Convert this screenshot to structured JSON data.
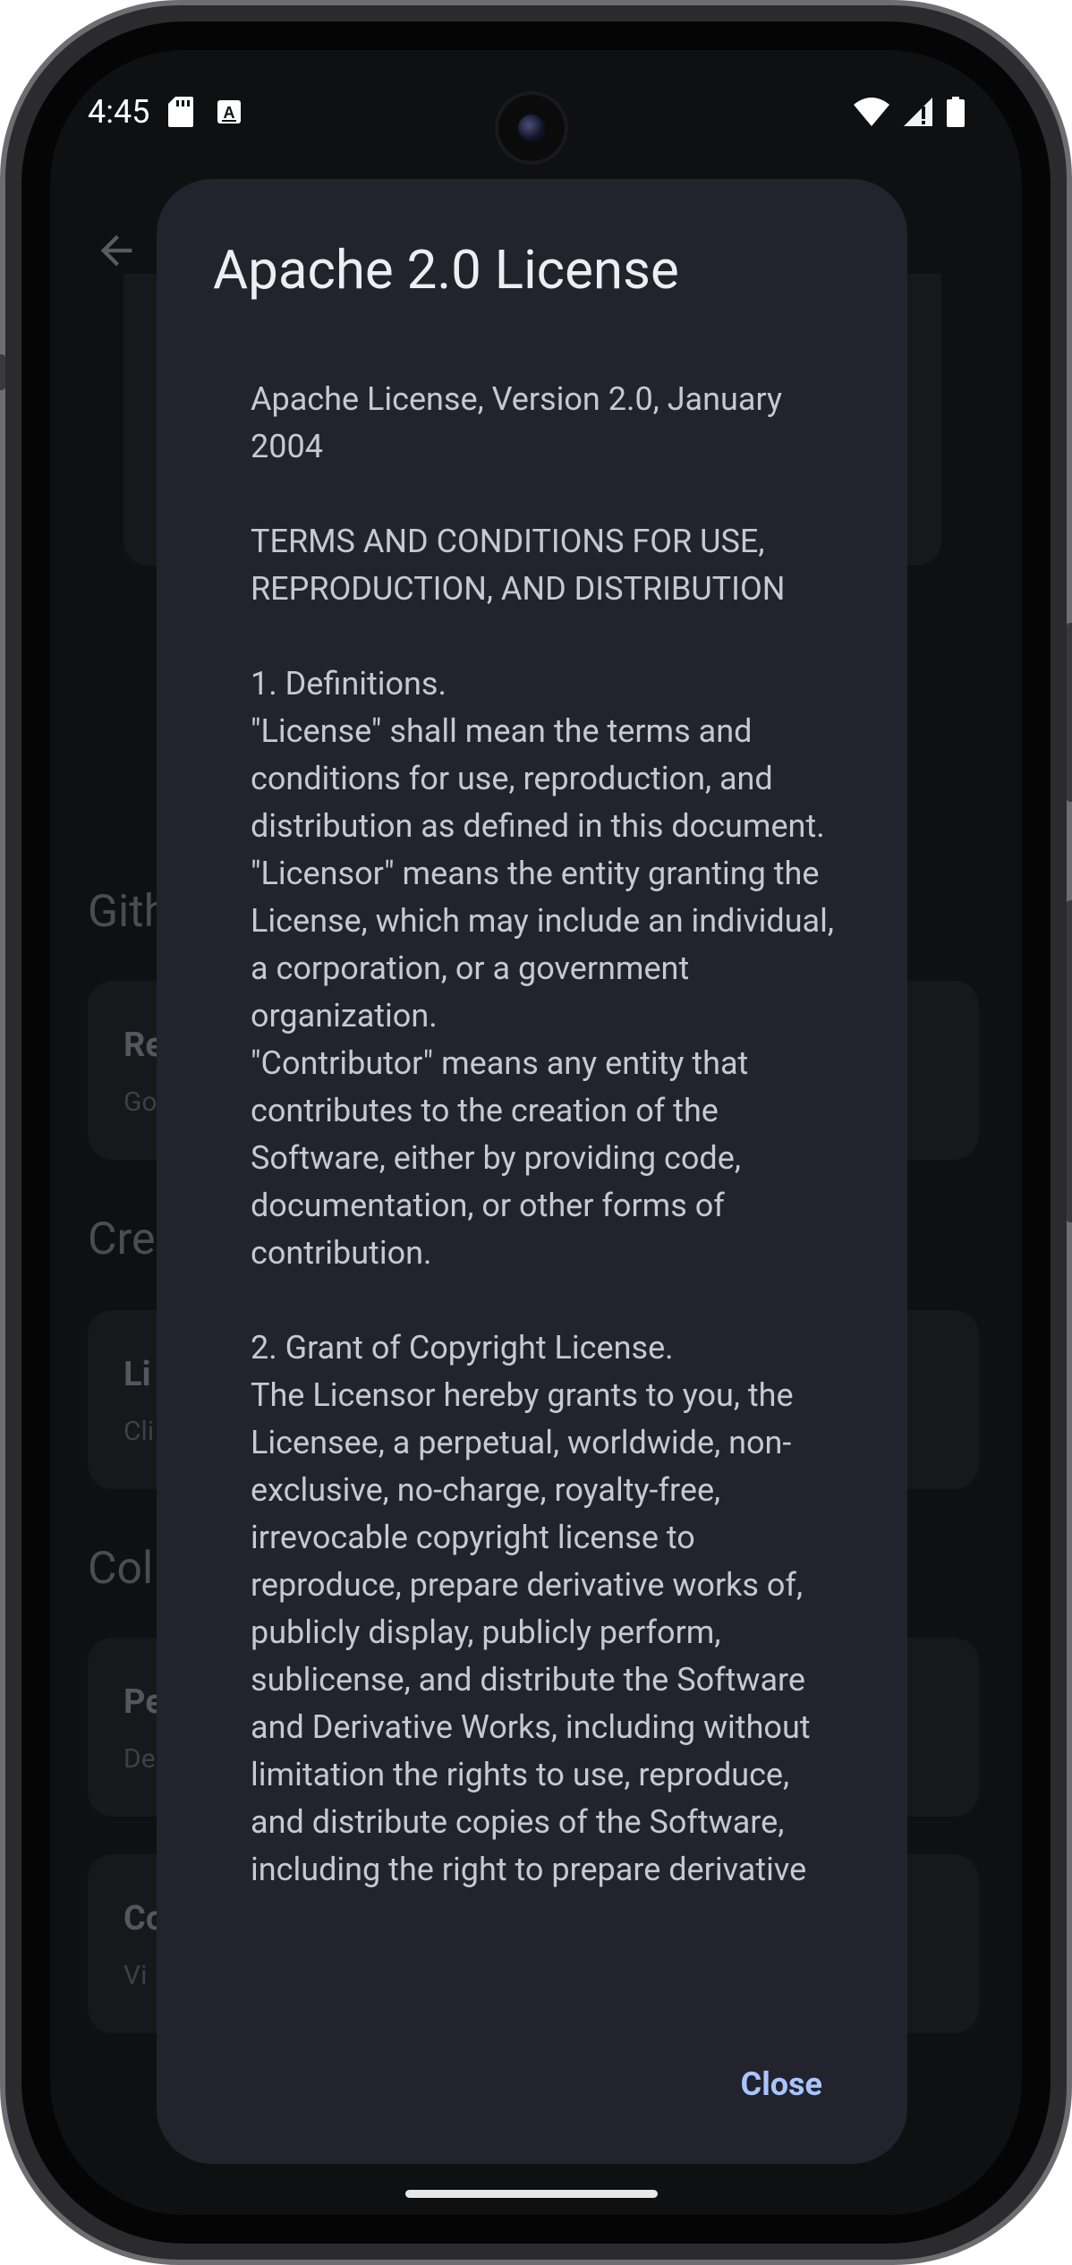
{
  "status_bar": {
    "time": "4:45"
  },
  "background": {
    "sections": [
      {
        "title": "Gith",
        "card_title": "Re",
        "card_sub": "Go"
      },
      {
        "title": "Cre",
        "card_title": "Li",
        "card_sub": "Cli"
      },
      {
        "title": "Col",
        "card_title": "Pe",
        "card_sub": "De"
      }
    ],
    "extra_card": {
      "title": "Co",
      "sub": "Vi"
    }
  },
  "dialog": {
    "title": "Apache 2.0 License",
    "body": "Apache License, Version 2.0, January 2004\n\nTERMS AND CONDITIONS FOR USE, REPRODUCTION, AND DISTRIBUTION\n\n1. Definitions.\n\"License\" shall mean the terms and conditions for use, reproduction, and distribution as defined in this document.\n\"Licensor\" means the entity granting the License, which may include an individual, a corporation, or a government organization.\n\"Contributor\" means any entity that contributes to the creation of the Software, either by providing code, documentation, or other forms of contribution.\n\n2. Grant of Copyright License.\nThe Licensor hereby grants to you, the Licensee, a perpetual, worldwide, non-exclusive, no-charge, royalty-free, irrevocable copyright license to reproduce, prepare derivative works of, publicly display, publicly perform, sublicense, and distribute the Software and Derivative Works, including without limitation the rights to use, reproduce, and distribute copies of the Software, including the right to prepare derivative",
    "close_label": "Close"
  }
}
